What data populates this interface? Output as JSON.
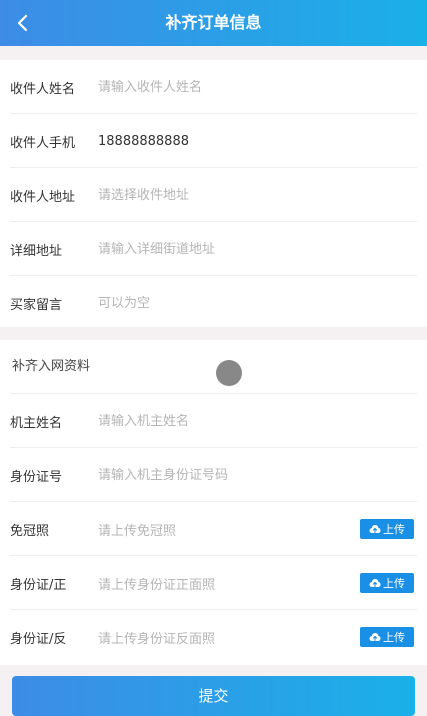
{
  "header": {
    "title": "补齐订单信息",
    "back_icon": "chevron-left-icon"
  },
  "order_info": {
    "fields": [
      {
        "label": "收件人姓名",
        "value": "",
        "placeholder": "请输入收件人姓名"
      },
      {
        "label": "收件人手机",
        "value": "18888888888",
        "placeholder": ""
      },
      {
        "label": "收件人地址",
        "value": "",
        "placeholder": "请选择收件地址"
      },
      {
        "label": "详细地址",
        "value": "",
        "placeholder": "请输入详细街道地址"
      },
      {
        "label": "买家留言",
        "value": "",
        "placeholder": "可以为空"
      }
    ]
  },
  "network_info": {
    "section_title": "补齐入网资料",
    "fields": [
      {
        "label": "机主姓名",
        "value": "",
        "placeholder": "请输入机主姓名"
      },
      {
        "label": "身份证号",
        "value": "",
        "placeholder": "请输入机主身份证号码"
      }
    ],
    "uploads": [
      {
        "label": "免冠照",
        "hint": "请上传免冠照",
        "button": "上传"
      },
      {
        "label": "身份证/正",
        "hint": "请上传身份证正面照",
        "button": "上传"
      },
      {
        "label": "身份证/反",
        "hint": "请上传身份证反面照",
        "button": "上传"
      }
    ],
    "upload_icon": "cloud-upload-icon"
  },
  "footer": {
    "submit_label": "提交"
  },
  "colors": {
    "header_start": "#3d8ce6",
    "header_end": "#1ab0e8",
    "upload_button": "#1a8fe6"
  }
}
